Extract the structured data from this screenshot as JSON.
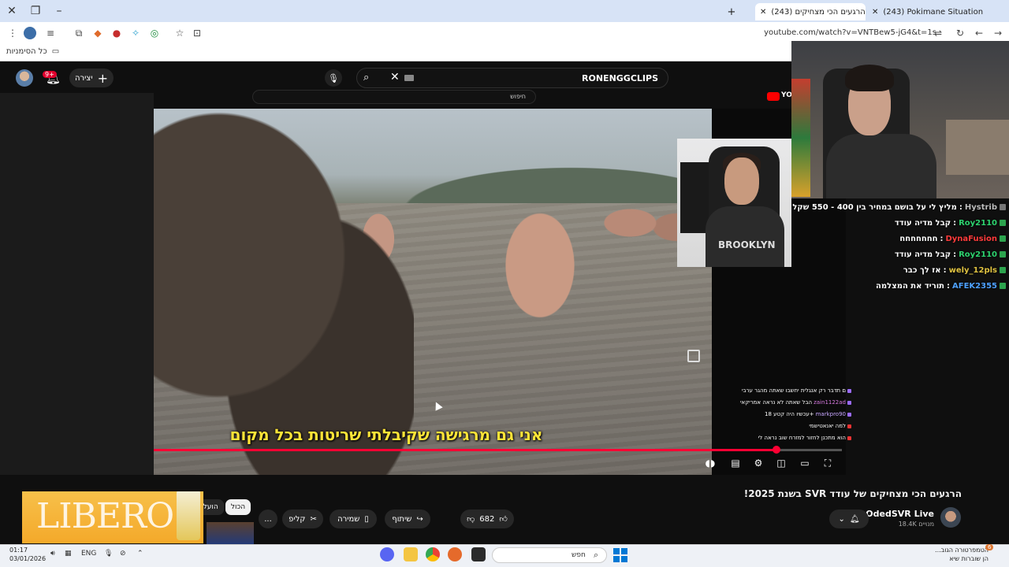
{
  "browser": {
    "tabs": [
      {
        "title": "(243) הרגעים הכי מצחיקים",
        "active": true
      },
      {
        "title": "(243) Pokimane Situation is Path",
        "active": false
      }
    ],
    "url": "youtube.com/watch?v=VNTBew5-jG4&t=1s",
    "bookmarks_label": "כל הסימניות"
  },
  "youtube": {
    "search_query": "RONENGGCLIPS",
    "create_label": "יצירה",
    "notifications_badge": "9+",
    "echo_search_placeholder": "חיפוש",
    "echo_logo": "YO",
    "subtitle": "אני גם מרגישה שקיבלתי שריטות בכל מקום",
    "progress_fraction": 0.905,
    "video_title": "הרגעים הכי מצחיקים של עודד SVR בשנת 2025!",
    "channel_name": "OdedSVR Live",
    "channel_subs": "18.4K מנויים",
    "like_count": "682",
    "share_label": "שיתוף",
    "save_label": "שמירה",
    "clip_label": "קליפ",
    "more_label": "...",
    "chip_all": "הכול",
    "chip_uploaded": "הועלו"
  },
  "ad": {
    "brand": "LIBERO"
  },
  "webcam_small": {
    "shirt_text": "BROOKLYN"
  },
  "chat": [
    {
      "user": "Hystrib",
      "message": "מליץ לי על בושם במחיר בין 400 - 550 שקל",
      "color": "#bdbdbd"
    },
    {
      "user": "Roy2110",
      "message": "קבל מדיה עודד",
      "color": "#2dd36f"
    },
    {
      "user": "DynaFusion",
      "message": "חחחחחחח",
      "color": "#ff3b3b"
    },
    {
      "user": "Roy2110",
      "message": "קבל מדיה עודד",
      "color": "#2dd36f"
    },
    {
      "user": "wely_12pls",
      "message": "אז לך כבר",
      "color": "#e0c341"
    },
    {
      "user": "AFEK2355",
      "message": "תוריד את המצלמה",
      "color": "#4ea1ff"
    }
  ],
  "small_chat": [
    {
      "user": "",
      "message": "ם תדבר רק אנגלית יחשבו שאתה מהגר ערבי"
    },
    {
      "user": "zain1122ad",
      "message": "הבל שאתה לא נראה אמריקאי"
    },
    {
      "user": "markpro90",
      "message": "עכשיו היה קטע 18+"
    },
    {
      "user": "",
      "message": "למה יאנאטישמי"
    },
    {
      "user": "",
      "message": "הוא מתכנן לחזור למזרח שוב נראה לי"
    }
  ],
  "taskbar": {
    "time": "01:17",
    "date": "03/01/2026",
    "language": "ENG",
    "search_label": "חפש",
    "weather_title": "הטמפרטורה הגוב...",
    "weather_sub": "הן שוברות שיא",
    "weather_badge": "6"
  }
}
